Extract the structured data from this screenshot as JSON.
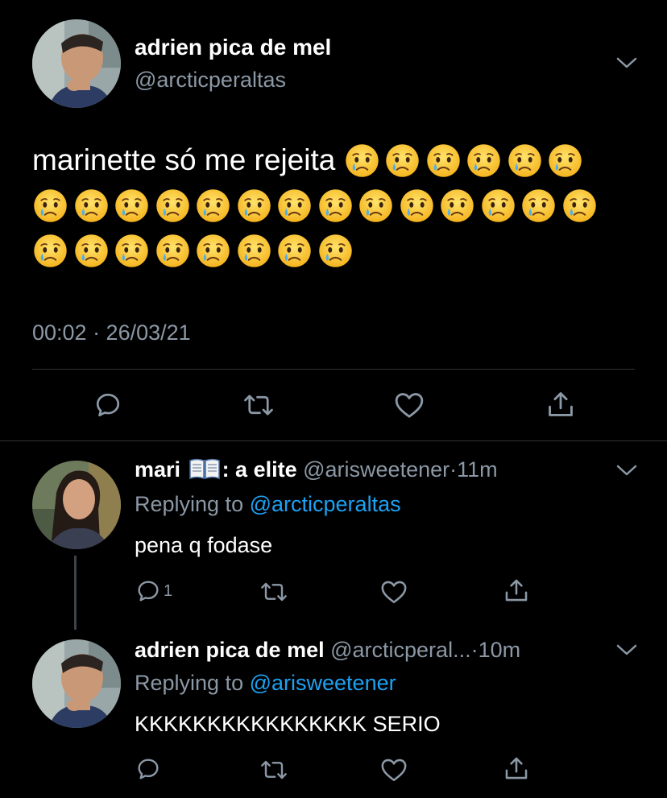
{
  "main_tweet": {
    "author_name": "adrien pica de mel",
    "handle": "@arcticperaltas",
    "text": "marinette só me rejeita",
    "emoji_count": 28,
    "timestamp": "00:02 · 26/03/21"
  },
  "replies": [
    {
      "author_name": "mari",
      "author_suffix": ": a elite",
      "badge_icon": "open-book-emoji",
      "handle": "@arisweetener",
      "separator": "·",
      "time": "11m",
      "replying_prefix": "Replying to",
      "replying_to": "@arcticperaltas",
      "text": "pena q fodase",
      "reply_count": "1"
    },
    {
      "author_name": "adrien pica de mel",
      "handle": "@arcticperal...",
      "separator": "·",
      "time": "10m",
      "replying_prefix": "Replying to",
      "replying_to": "@arisweetener",
      "text": "KKKKKKKKKKKKKKKK SERIO"
    }
  ],
  "icons": {
    "reply": "reply-icon",
    "retweet": "retweet-icon",
    "like": "heart-icon",
    "share": "share-icon",
    "more": "chevron-down-icon",
    "emoji": "crying-face-emoji"
  },
  "colors": {
    "background": "#000000",
    "text": "#ffffff",
    "muted": "#8b98a5",
    "link": "#1da1f2",
    "divider": "#2f3336"
  }
}
